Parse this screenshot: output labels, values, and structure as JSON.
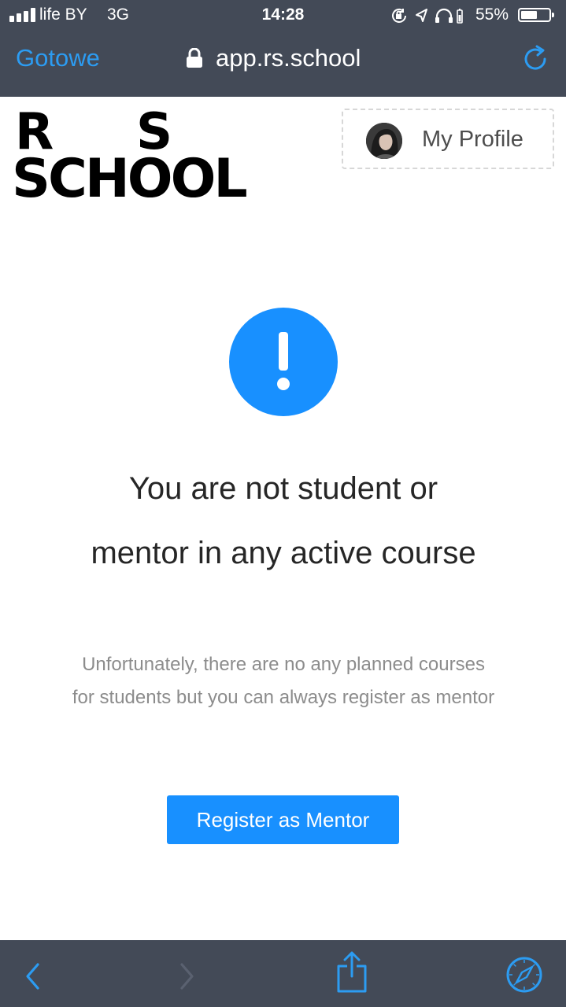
{
  "status_bar": {
    "carrier": "life BY",
    "network": "3G",
    "time": "14:28",
    "battery_percent": "55%",
    "icons": [
      "signal-icon",
      "rotation-lock-icon",
      "location-icon",
      "headphones-icon",
      "battery-icon"
    ]
  },
  "browser": {
    "done_label": "Gotowe",
    "url": "app.rs.school",
    "icons": [
      "lock-icon",
      "reload-icon"
    ]
  },
  "header": {
    "logo": {
      "row1_left": "R",
      "row1_right": "S",
      "row2": "SCHOOL"
    },
    "profile_label": "My Profile"
  },
  "result": {
    "title": "You are not student or mentor in any active course",
    "subtitle": "Unfortunately, there are no any planned courses for students but you can always register as mentor",
    "button_label": "Register as Mentor",
    "accent_color": "#1890ff",
    "icon": "exclamation-circle-icon"
  },
  "toolbar": {
    "icons": [
      "back-icon",
      "forward-icon",
      "share-icon",
      "safari-compass-icon"
    ],
    "background": "#434a57",
    "tint": "#2c9cf2"
  }
}
